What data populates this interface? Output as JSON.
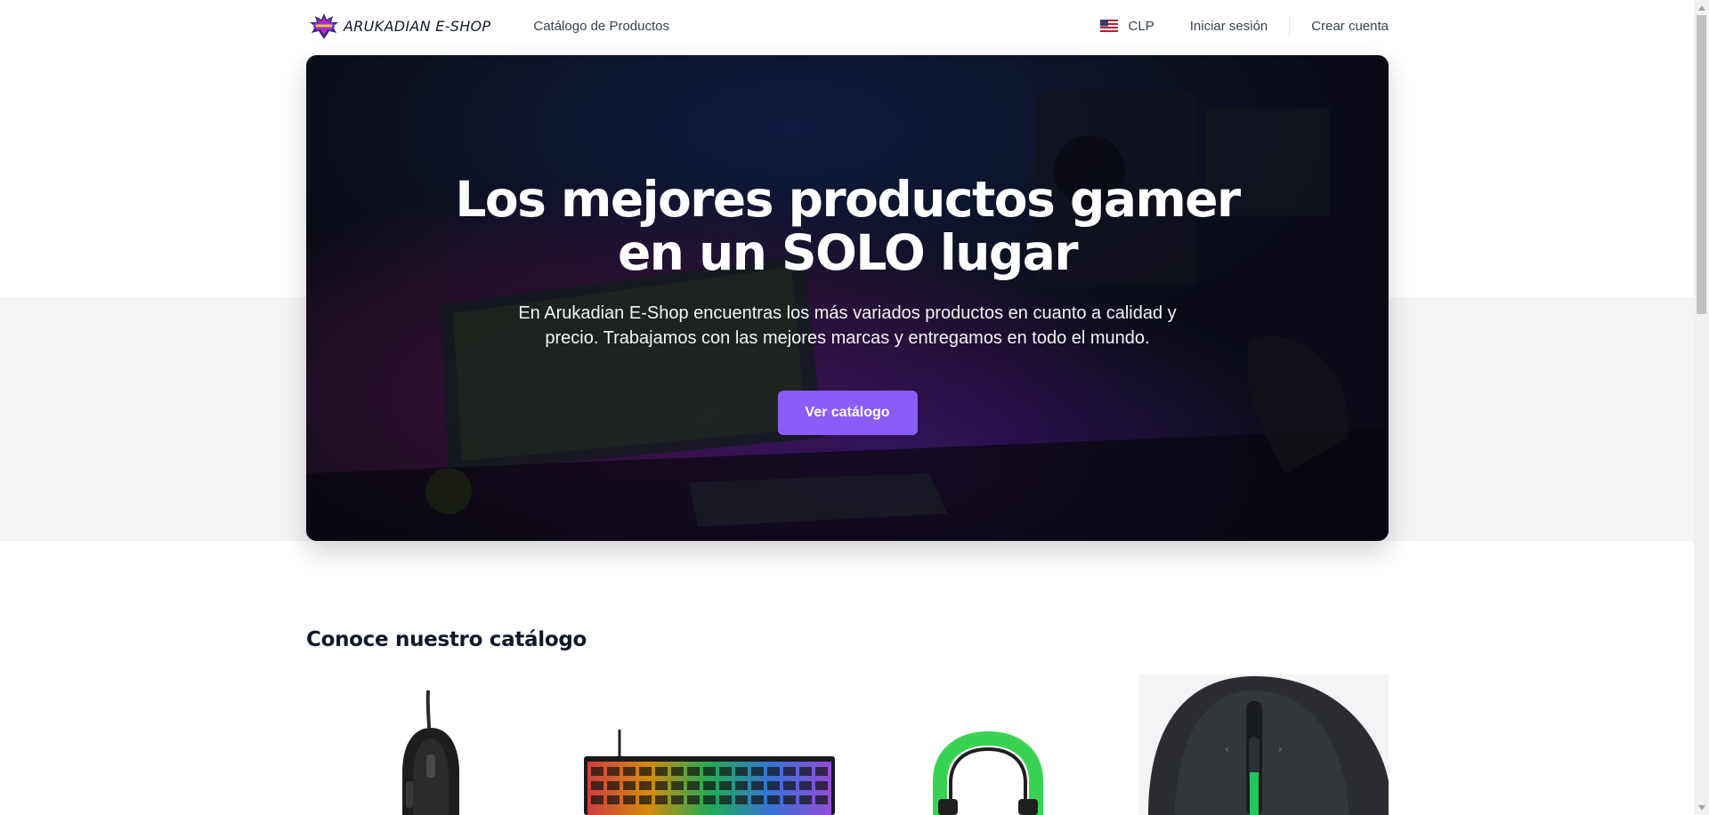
{
  "header": {
    "brand": "ARUKADIAN E-SHOP",
    "nav_catalog": "Catálogo de Productos",
    "currency": "CLP",
    "login": "Iniciar sesión",
    "signup": "Crear cuenta"
  },
  "hero": {
    "title": "Los mejores productos gamer en un SOLO lugar",
    "subtitle": "En Arukadian E-Shop encuentras los más variados productos en cuanto a calidad y precio. Trabajamos con las mejores marcas y entregamos en todo el mundo.",
    "cta": "Ver catálogo"
  },
  "catalog": {
    "title": "Conoce nuestro catálogo",
    "products": [
      {
        "name": "gaming-mouse"
      },
      {
        "name": "rgb-keyboard"
      },
      {
        "name": "green-headset"
      },
      {
        "name": "mmo-mouse"
      }
    ]
  },
  "colors": {
    "accent": "#8b5cf6",
    "hero_dark": "#0f1020",
    "band": "#f3f4f6"
  },
  "icons": {
    "logo": "arukadian-logo-icon",
    "flag": "us-flag-icon"
  }
}
